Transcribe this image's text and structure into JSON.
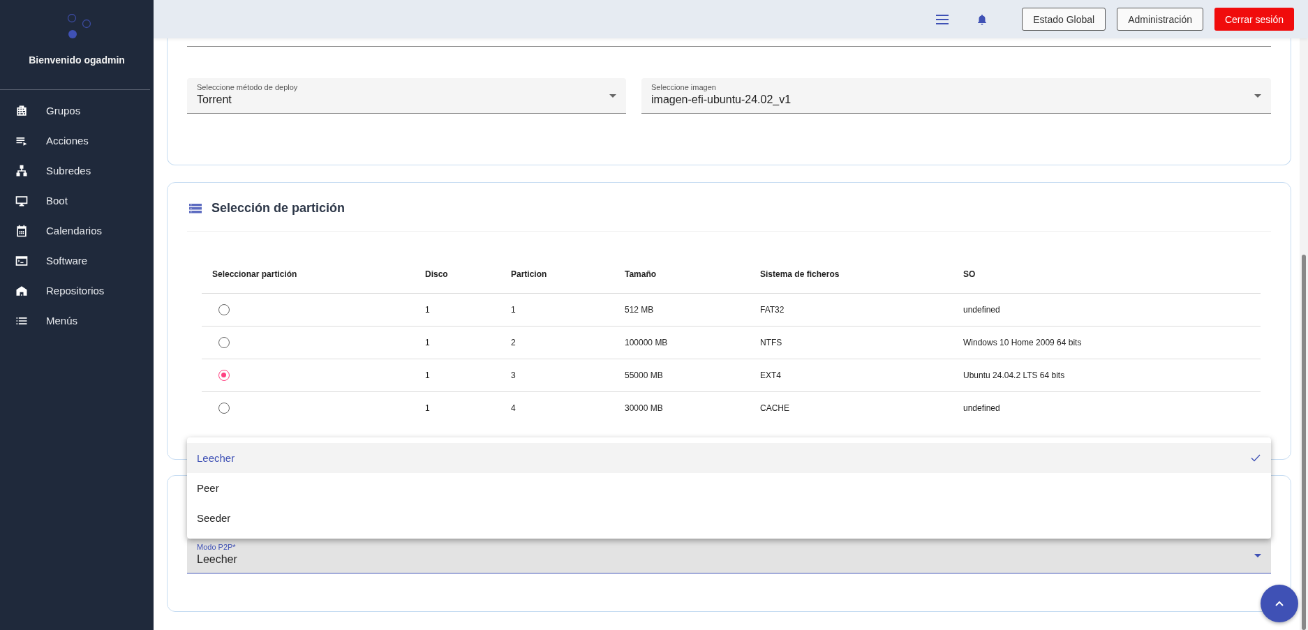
{
  "sidebar": {
    "welcome": "Bienvenido ogadmin",
    "items": [
      {
        "label": "Grupos"
      },
      {
        "label": "Acciones"
      },
      {
        "label": "Subredes"
      },
      {
        "label": "Boot"
      },
      {
        "label": "Calendarios"
      },
      {
        "label": "Software"
      },
      {
        "label": "Repositorios"
      },
      {
        "label": "Menús"
      }
    ]
  },
  "topbar": {
    "buttons": [
      {
        "label": "Estado Global",
        "kind": "outline"
      },
      {
        "label": "Administración",
        "kind": "outline"
      },
      {
        "label": "Cerrar sesión",
        "kind": "danger"
      }
    ]
  },
  "deploy": {
    "fields": [
      {
        "label": "Seleccione método de deploy",
        "value": "Torrent"
      },
      {
        "label": "Seleccione imagen",
        "value": "imagen-efi-ubuntu-24.02_v1"
      }
    ]
  },
  "partition": {
    "title": "Selección de partición",
    "columns": [
      "Seleccionar partición",
      "Disco",
      "Particion",
      "Tamaño",
      "Sistema de ficheros",
      "SO"
    ],
    "rows": [
      {
        "selected": false,
        "cells": [
          "",
          "1",
          "1",
          "512 MB",
          "FAT32",
          "undefined"
        ]
      },
      {
        "selected": false,
        "cells": [
          "",
          "1",
          "2",
          "100000 MB",
          "NTFS",
          "Windows 10 Home 2009 64 bits"
        ]
      },
      {
        "selected": true,
        "cells": [
          "",
          "1",
          "3",
          "55000 MB",
          "EXT4",
          "Ubuntu 24.04.2 LTS 64 bits"
        ]
      },
      {
        "selected": false,
        "cells": [
          "",
          "1",
          "4",
          "30000 MB",
          "CACHE",
          "undefined"
        ]
      }
    ]
  },
  "p2p": {
    "label": "Modo P2P*",
    "value": "Leecher",
    "expanded": true,
    "options": [
      {
        "label": "Leecher",
        "selected": true
      },
      {
        "label": "Peer",
        "selected": false
      },
      {
        "label": "Seeder",
        "selected": false
      }
    ]
  }
}
